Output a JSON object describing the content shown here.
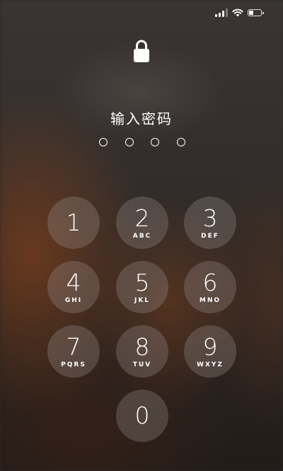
{
  "status_bar": {
    "signal_icon": "cellular-signal-icon",
    "wifi_icon": "wifi-icon",
    "battery_icon": "battery-icon",
    "battery_level": 0.35
  },
  "lock_icon": "lock-icon",
  "prompt": "输入密码",
  "passcode": {
    "length": 4,
    "entered": 0
  },
  "keypad": {
    "keys": [
      {
        "digit": "1",
        "letters": ""
      },
      {
        "digit": "2",
        "letters": "ABC"
      },
      {
        "digit": "3",
        "letters": "DEF"
      },
      {
        "digit": "4",
        "letters": "GHI"
      },
      {
        "digit": "5",
        "letters": "JKL"
      },
      {
        "digit": "6",
        "letters": "MNO"
      },
      {
        "digit": "7",
        "letters": "PQRS"
      },
      {
        "digit": "8",
        "letters": "TUV"
      },
      {
        "digit": "9",
        "letters": "WXYZ"
      },
      {
        "digit": "0",
        "letters": ""
      }
    ]
  }
}
